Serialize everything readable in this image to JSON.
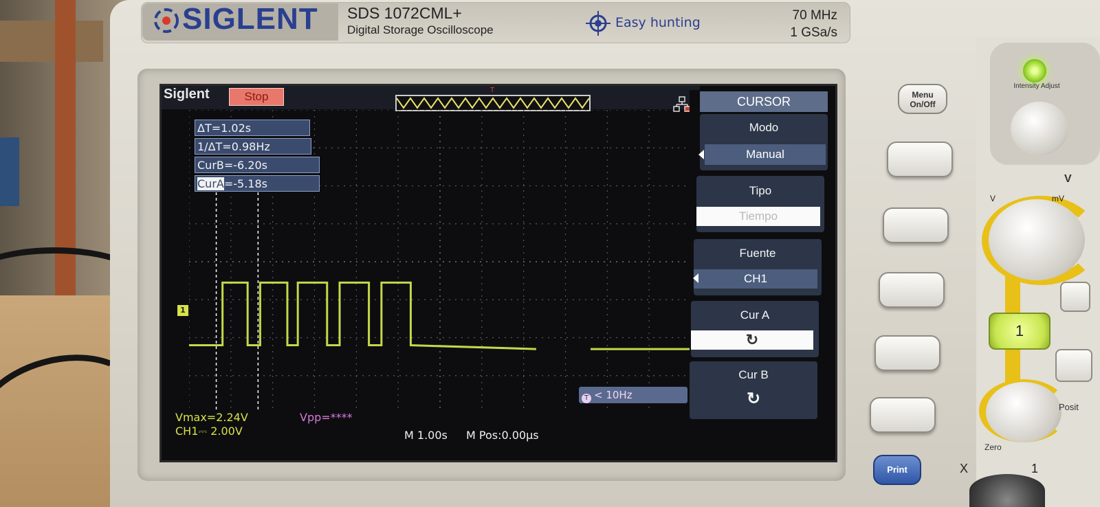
{
  "device": {
    "brand": "SIGLENT",
    "model": "SDS 1072CML+",
    "subtitle": "Digital Storage Oscilloscope",
    "feature": "Easy hunting",
    "bandwidth": "70 MHz",
    "sample_rate": "1 GSa/s"
  },
  "screen": {
    "brand_mark": "Siglent",
    "run_state": "Stop",
    "trigger_marker": "T",
    "channel_marker": "1",
    "measurements": {
      "delta_t": "ΔT=1.02s",
      "inv_delta_t": "1/ΔT=0.98Hz",
      "cur_b": "CurB=-6.20s",
      "cur_a_label": "CurA",
      "cur_a_value": "=-5.18s"
    },
    "trigger_freq": "< 10Hz",
    "status": {
      "vmax": "Vmax=2.24V",
      "vpp": "Vpp=****",
      "ch1_scale": "CH1⎓ 2.00V",
      "timebase": "M 1.00s",
      "position": "M Pos:0.00µs"
    }
  },
  "menu": {
    "title": "CURSOR",
    "items": [
      {
        "label": "Modo",
        "value": "Manual"
      },
      {
        "label": "Tipo",
        "value": "Tiempo"
      },
      {
        "label": "Fuente",
        "value": "CH1"
      },
      {
        "label": "Cur A",
        "value": "↻"
      },
      {
        "label": "Cur B",
        "value": "↻"
      }
    ]
  },
  "controls": {
    "menu_button": "Menu On/Off",
    "print_button": "Print",
    "intensity_label": "Intensity Adjust",
    "v_label": "V",
    "mv_label": "mV",
    "v_cut": "V",
    "ch1_button": "1",
    "position_label": "Posit",
    "zero_label": "Zero",
    "x_label": "X",
    "one_label": "1"
  },
  "colors": {
    "trace": "#c4d84a",
    "menu_header": "#5e6d8a",
    "stop_badge": "#e8786b",
    "status_yellow": "#d8e24a",
    "status_magenta": "#d87ad8"
  },
  "waveform": {
    "channel": "CH1",
    "volts_per_div": 2.0,
    "seconds_per_div": 1.0,
    "baseline_div": -0.1,
    "high_div": 1.55,
    "pulses_div": [
      [
        0.8,
        1.4
      ],
      [
        1.7,
        2.35
      ],
      [
        2.6,
        3.3
      ],
      [
        3.6,
        4.3
      ],
      [
        4.6,
        5.3
      ]
    ],
    "tail_level_div": -0.2,
    "gap_div": [
      8.3,
      9.6
    ],
    "cursor_a_div": 1.65,
    "cursor_b_div": 0.65
  }
}
